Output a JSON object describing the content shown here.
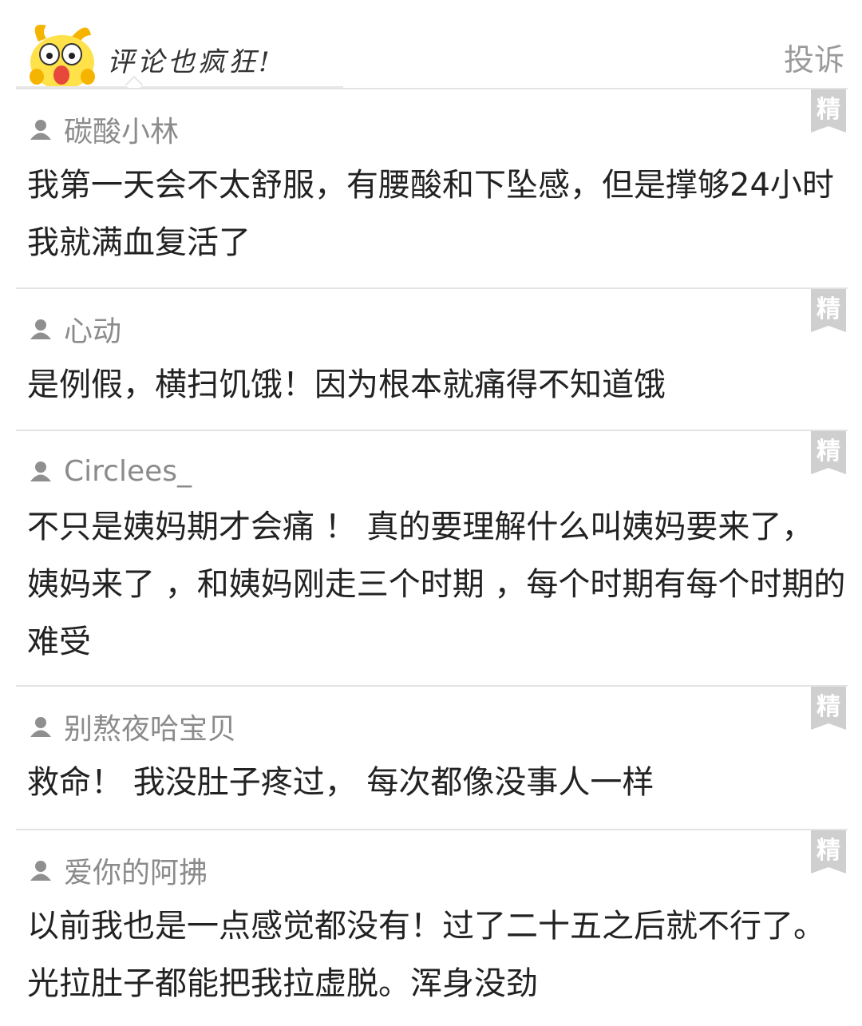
{
  "header": {
    "title": "评论也疯狂!",
    "report_label": "投诉"
  },
  "comments": [
    {
      "badge": "精",
      "username": "碳酸小林",
      "text": "我第一天会不太舒服，有腰酸和下坠感，但是撑够24小时我就满血复活了"
    },
    {
      "badge": "精",
      "username": "心动",
      "text": "是例假，横扫饥饿！因为根本就痛得不知道饿"
    },
    {
      "badge": "精",
      "username": "Circlees_",
      "text": "不只是姨妈期才会痛 ！ 真的要理解什么叫姨妈要来了， 姨妈来了 ，和姨妈刚走三个时期 ，每个时期有每个时期的难受"
    },
    {
      "badge": "精",
      "username": "别熬夜哈宝贝",
      "text": "救命！ 我没肚子疼过， 每次都像没事人一样"
    },
    {
      "badge": "精",
      "username": "爱你的阿拂",
      "text": "以前我也是一点感觉都没有！过了二十五之后就不行了。光拉肚子都能把我拉虚脱。浑身没劲"
    }
  ]
}
